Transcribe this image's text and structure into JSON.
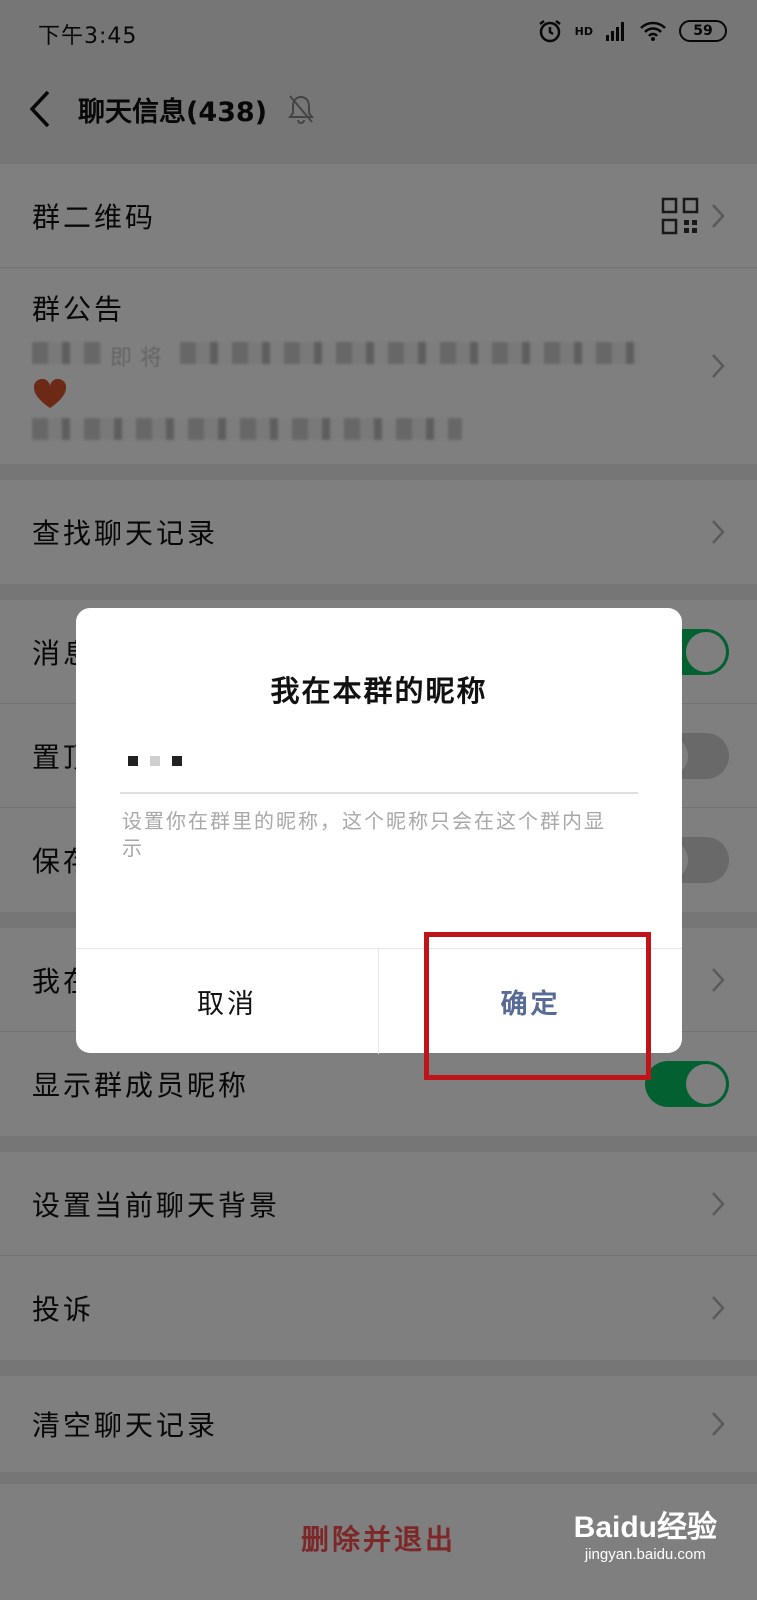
{
  "status_bar": {
    "time": "下午3:45",
    "network": "HD",
    "battery": "59",
    "icons": [
      "alarm-icon",
      "signal-icon",
      "wifi-icon",
      "battery-icon"
    ]
  },
  "nav": {
    "title": "聊天信息(438)",
    "icons": [
      "back-icon",
      "bell-off-icon"
    ]
  },
  "rows": {
    "qr_code": "群二维码",
    "announcement_label": "群公告",
    "announcement_preview": "即将",
    "search_history": "查找聊天记录",
    "mute": "消息",
    "pin": "置顶",
    "save": "保存",
    "my_nickname": "我在",
    "show_member_names": "显示群成员昵称",
    "chat_background": "设置当前聊天背景",
    "report": "投诉",
    "clear_history": "清空聊天记录"
  },
  "toggles": {
    "mute_on": true,
    "pin_on": false,
    "save_on": false,
    "show_member_names_on": true
  },
  "bottom": {
    "delete_exit": "删除并退出",
    "watermark_logo": "Baidu经验",
    "watermark_url": "jingyan.baidu.com"
  },
  "dialog": {
    "title": "我在本群的昵称",
    "input_value": "",
    "hint": "设置你在群里的昵称，这个昵称只会在这个群内显示",
    "cancel_label": "取消",
    "confirm_label": "确定"
  },
  "colors": {
    "accent_green": "#07c160",
    "confirm_blue": "#576b95",
    "danger_red": "#fa5151",
    "highlight_red": "#c0141b"
  }
}
